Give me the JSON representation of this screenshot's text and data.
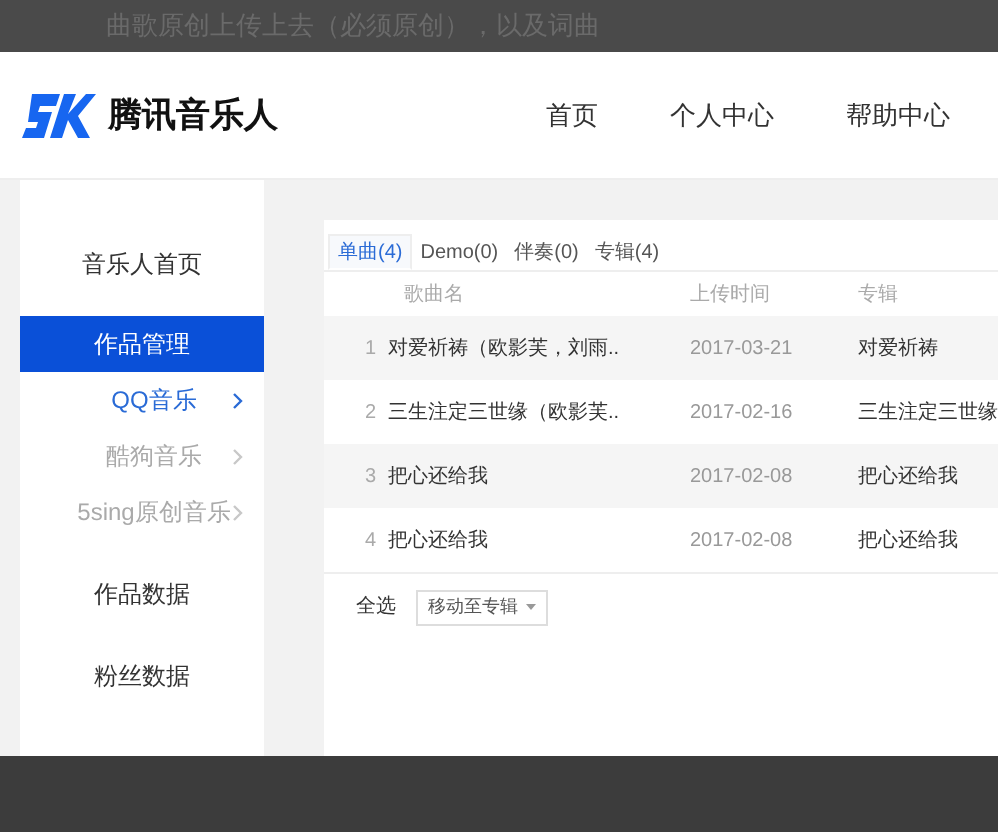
{
  "overlay_top": {
    "text": "曲歌原创上传上去（必须原创），以及词曲"
  },
  "header": {
    "logo_text": "腾讯音乐人",
    "nav": [
      {
        "label": "首页"
      },
      {
        "label": "个人中心"
      },
      {
        "label": "帮助中心"
      }
    ]
  },
  "sidebar": {
    "items": [
      {
        "label": "音乐人首页",
        "kind": "main",
        "selected": false
      },
      {
        "label": "作品管理",
        "kind": "main",
        "selected": true
      },
      {
        "label": "QQ音乐",
        "kind": "sub",
        "selected": true
      },
      {
        "label": "酷狗音乐",
        "kind": "sub",
        "selected": false
      },
      {
        "label": "5sing原创音乐",
        "kind": "sub",
        "selected": false
      },
      {
        "label": "作品数据",
        "kind": "main",
        "selected": false
      },
      {
        "label": "粉丝数据",
        "kind": "main",
        "selected": false
      }
    ]
  },
  "tabs": [
    {
      "label": "单曲(4)",
      "selected": true
    },
    {
      "label": "Demo(0)",
      "selected": false
    },
    {
      "label": "伴奏(0)",
      "selected": false
    },
    {
      "label": "专辑(4)",
      "selected": false
    }
  ],
  "table": {
    "columns": [
      "歌曲名",
      "上传时间",
      "专辑"
    ],
    "rows": [
      {
        "index": "1",
        "name": "对爱祈祷（欧影芙，刘雨..",
        "date": "2017-03-21",
        "album": "对爱祈祷"
      },
      {
        "index": "2",
        "name": "三生注定三世缘（欧影芙..",
        "date": "2017-02-16",
        "album": "三生注定三世缘"
      },
      {
        "index": "3",
        "name": "把心还给我",
        "date": "2017-02-08",
        "album": "把心还给我"
      },
      {
        "index": "4",
        "name": "把心还给我",
        "date": "2017-02-08",
        "album": "把心还给我"
      }
    ]
  },
  "footer": {
    "select_all": "全选",
    "move_select": "移动至专辑"
  }
}
